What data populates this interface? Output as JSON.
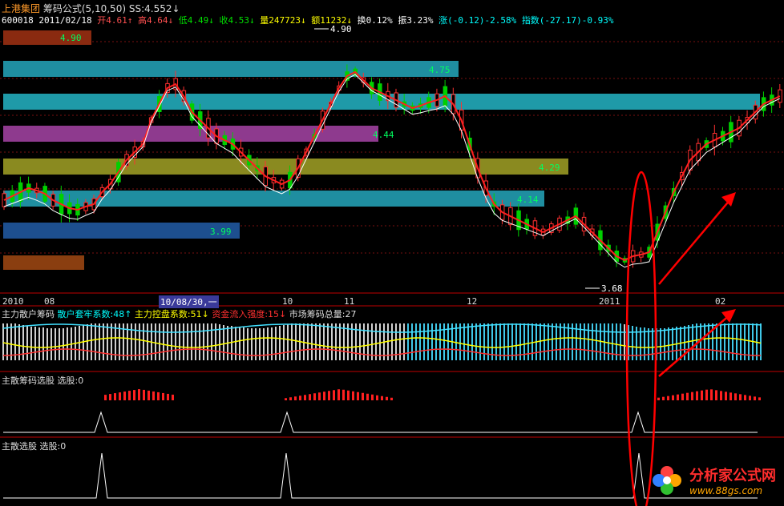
{
  "header": {
    "stock_name": "上港集团",
    "indicator": "筹码公式(5,10,50)",
    "ss": "SS:4.552↓"
  },
  "infobar": {
    "code": "600018",
    "date": "2011/02/18",
    "open": "开4.61↑",
    "high": "高4.64↓",
    "low": "低4.49↓",
    "close": "收4.53↓",
    "volume": "量247723↓",
    "amount": "额11232↓",
    "turnover": "换0.12%",
    "amplitude": "振3.23%",
    "change": "涨(-0.12)-2.58%",
    "index": "指数(-27.17)-0.93%"
  },
  "price_bands": [
    {
      "label": "4.90",
      "color": "#8a2a10"
    },
    {
      "label": "4.75",
      "color": "#1f8ea0"
    },
    {
      "label": "",
      "color": "#1f9aa8"
    },
    {
      "label": "4.44",
      "color": "#8e3a8e"
    },
    {
      "label": "4.29",
      "color": "#8a8a20"
    },
    {
      "label": "4.14",
      "color": "#1f8ea0"
    },
    {
      "label": "3.99",
      "color": "#1d4f8f"
    },
    {
      "label": "",
      "color": "#8a3e10"
    }
  ],
  "price_annotations": {
    "high_marker": "4.90",
    "low_marker": "3.68"
  },
  "x_axis": {
    "labels": [
      "2010",
      "08",
      "10/08/30,一",
      "10",
      "11",
      "12",
      "2011",
      "02"
    ]
  },
  "panel2": {
    "title": "主力散户筹码",
    "a": "散户套牢系数:48↑",
    "b": "主力控盘系数:51↓",
    "c": "资金流入强度:15↓",
    "d": "市场筹码总量:27"
  },
  "panel3": {
    "title": "主散筹码选股",
    "value": "选股:0"
  },
  "panel4": {
    "title": "主散选股",
    "value": "选股:0"
  },
  "logo": {
    "name": "分析家公式网",
    "url": "www.88gs.com"
  },
  "colors": {
    "up": "#ff3030",
    "down": "#00d000",
    "ma": "#ff2020",
    "ma_long": "#ffffff",
    "divider": "#c00000"
  }
}
